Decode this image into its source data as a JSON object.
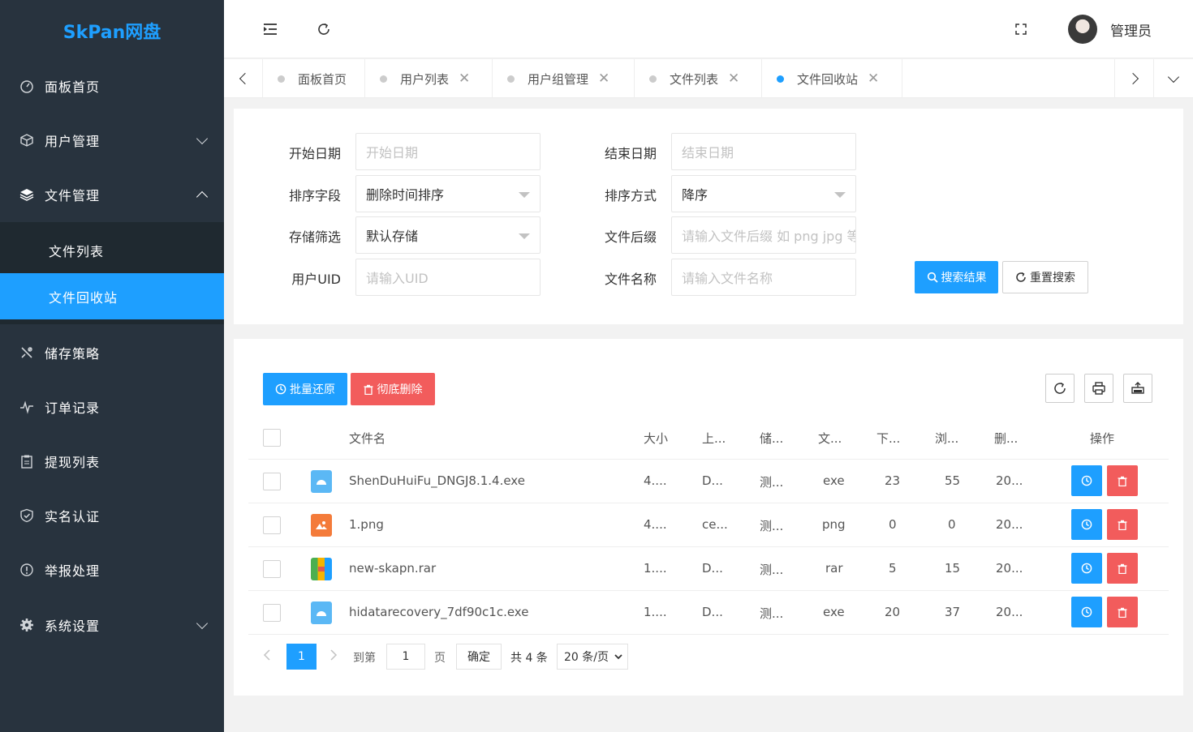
{
  "app": {
    "logo": "SkPan网盘"
  },
  "sidebar": {
    "items": [
      {
        "label": "面板首页",
        "icon": "dashboard-icon"
      },
      {
        "label": "用户管理",
        "icon": "cube-icon"
      },
      {
        "label": "文件管理",
        "icon": "layers-icon"
      },
      {
        "label": "储存策略",
        "icon": "tools-icon"
      },
      {
        "label": "订单记录",
        "icon": "pulse-icon"
      },
      {
        "label": "提现列表",
        "icon": "clipboard-icon"
      },
      {
        "label": "实名认证",
        "icon": "shield-check-icon"
      },
      {
        "label": "举报处理",
        "icon": "info-circle-icon"
      },
      {
        "label": "系统设置",
        "icon": "gear-icon"
      }
    ],
    "sub_items": [
      {
        "label": "文件列表"
      },
      {
        "label": "文件回收站"
      }
    ]
  },
  "header": {
    "user_name": "管理员"
  },
  "tabs": [
    {
      "label": "面板首页"
    },
    {
      "label": "用户列表"
    },
    {
      "label": "用户组管理"
    },
    {
      "label": "文件列表"
    },
    {
      "label": "文件回收站"
    }
  ],
  "search": {
    "start_date_label": "开始日期",
    "start_date_placeholder": "开始日期",
    "end_date_label": "结束日期",
    "end_date_placeholder": "结束日期",
    "sort_field_label": "排序字段",
    "sort_field_value": "删除时间排序",
    "sort_order_label": "排序方式",
    "sort_order_value": "降序",
    "storage_label": "存储筛选",
    "storage_value": "默认存储",
    "suffix_label": "文件后缀",
    "suffix_placeholder": "请输入文件后缀 如 png jpg 等",
    "uid_label": "用户UID",
    "uid_placeholder": "请输入UID",
    "filename_label": "文件名称",
    "filename_placeholder": "请输入文件名称",
    "search_button": "搜索结果",
    "reset_button": "重置搜索"
  },
  "table": {
    "batch_restore": "批量还原",
    "delete_forever": "彻底删除",
    "columns": [
      "文件名",
      "大小",
      "上...",
      "储...",
      "文...",
      "下...",
      "浏...",
      "删...",
      "操作"
    ],
    "rows": [
      {
        "name": "ShenDuHuiFu_DNGJ8.1.4.exe",
        "size": "4....",
        "uploader": "D...",
        "storage": "测...",
        "ext": "exe",
        "downloads": "23",
        "views": "55",
        "deleted": "20...",
        "icon": "exe-file-icon",
        "color": "#5bb8f5"
      },
      {
        "name": "1.png",
        "size": "4....",
        "uploader": "ce...",
        "storage": "测...",
        "ext": "png",
        "downloads": "0",
        "views": "0",
        "deleted": "20...",
        "icon": "image-file-icon",
        "color": "#f47b3a"
      },
      {
        "name": "new-skapn.rar",
        "size": "1....",
        "uploader": "D...",
        "storage": "测...",
        "ext": "rar",
        "downloads": "5",
        "views": "15",
        "deleted": "20...",
        "icon": "archive-file-icon",
        "color": "#e05a4f"
      },
      {
        "name": "hidatarecovery_7df90c1c.exe",
        "size": "1....",
        "uploader": "D...",
        "storage": "测...",
        "ext": "exe",
        "downloads": "20",
        "views": "37",
        "deleted": "20...",
        "icon": "exe-file-icon",
        "color": "#5bb8f5"
      }
    ]
  },
  "pager": {
    "current": "1",
    "goto_label": "到第",
    "goto_value": "1",
    "page_unit": "页",
    "confirm": "确定",
    "total": "共 4 条",
    "page_size": "20 条/页"
  },
  "colors": {
    "accent": "#1e9fff",
    "sidebar": "#28333e",
    "danger": "#f25c5c"
  }
}
